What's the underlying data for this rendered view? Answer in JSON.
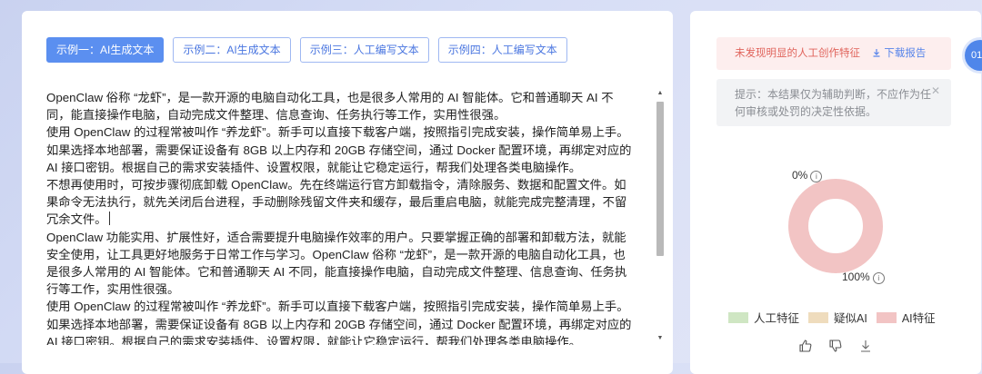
{
  "tabs": [
    {
      "label": "示例一：AI生成文本",
      "active": true
    },
    {
      "label": "示例二：AI生成文本",
      "active": false
    },
    {
      "label": "示例三：人工编写文本",
      "active": false
    },
    {
      "label": "示例四：人工编写文本",
      "active": false
    }
  ],
  "editor": {
    "paragraphs": [
      "OpenClaw 俗称 “龙虾”，是一款开源的电脑自动化工具，也是很多人常用的 AI 智能体。它和普通聊天 AI 不同，能直接操作电脑，自动完成文件整理、信息查询、任务执行等工作，实用性很强。",
      "使用 OpenClaw 的过程常被叫作 “养龙虾”。新手可以直接下载客户端，按照指引完成安装，操作简单易上手。如果选择本地部署，需要保证设备有 8GB 以上内存和 20GB 存储空间，通过 Docker 配置环境，再绑定对应的 AI 接口密钥。根据自己的需求安装插件、设置权限，就能让它稳定运行，帮我们处理各类电脑操作。",
      "不想再使用时，可按步骤彻底卸载 OpenClaw。先在终端运行官方卸载指令，清除服务、数据和配置文件。如果命令无法执行，就先关闭后台进程，手动删除残留文件夹和缓存，最后重启电脑，就能完成完整清理，不留冗余文件。",
      "OpenClaw 功能实用、扩展性好，适合需要提升电脑操作效率的用户。只要掌握正确的部署和卸载方法，就能安全使用，让工具更好地服务于日常工作与学习。OpenClaw 俗称 “龙虾”，是一款开源的电脑自动化工具，也是很多人常用的 AI 智能体。它和普通聊天 AI 不同，能直接操作电脑，自动完成文件整理、信息查询、任务执行等工作，实用性很强。",
      "使用 OpenClaw 的过程常被叫作 “养龙虾”。新手可以直接下载客户端，按照指引完成安装，操作简单易上手。如果选择本地部署，需要保证设备有 8GB 以上内存和 20GB 存储空间，通过 Docker 配置环境，再绑定对应的 AI 接口密钥。根据自己的需求安装插件、设置权限，就能让它稳定运行，帮我们处理各类电脑操作。"
    ]
  },
  "result": {
    "alert_text": "未发现明显的人工创作特征",
    "download_label": "下载报告",
    "hint_text": "提示：本结果仅为辅助判断，不应作为任何审核或处罚的决定性依据。",
    "badge_text": "01"
  },
  "chart_data": {
    "type": "pie",
    "donut": true,
    "slices": [
      {
        "label": "人工特征",
        "value": 0,
        "color": "#cfe6c3"
      },
      {
        "label": "疑似AI",
        "value": 0,
        "color": "#efdcbd"
      },
      {
        "label": "AI特征",
        "value": 100,
        "color": "#f2c4c4"
      }
    ],
    "labels": {
      "top": "0%",
      "bottom": "100%"
    },
    "legend_position": "bottom"
  },
  "icons": [
    "download-icon",
    "close-icon",
    "info-icon",
    "thumbs-up-icon",
    "thumbs-down-icon",
    "download-icon"
  ]
}
